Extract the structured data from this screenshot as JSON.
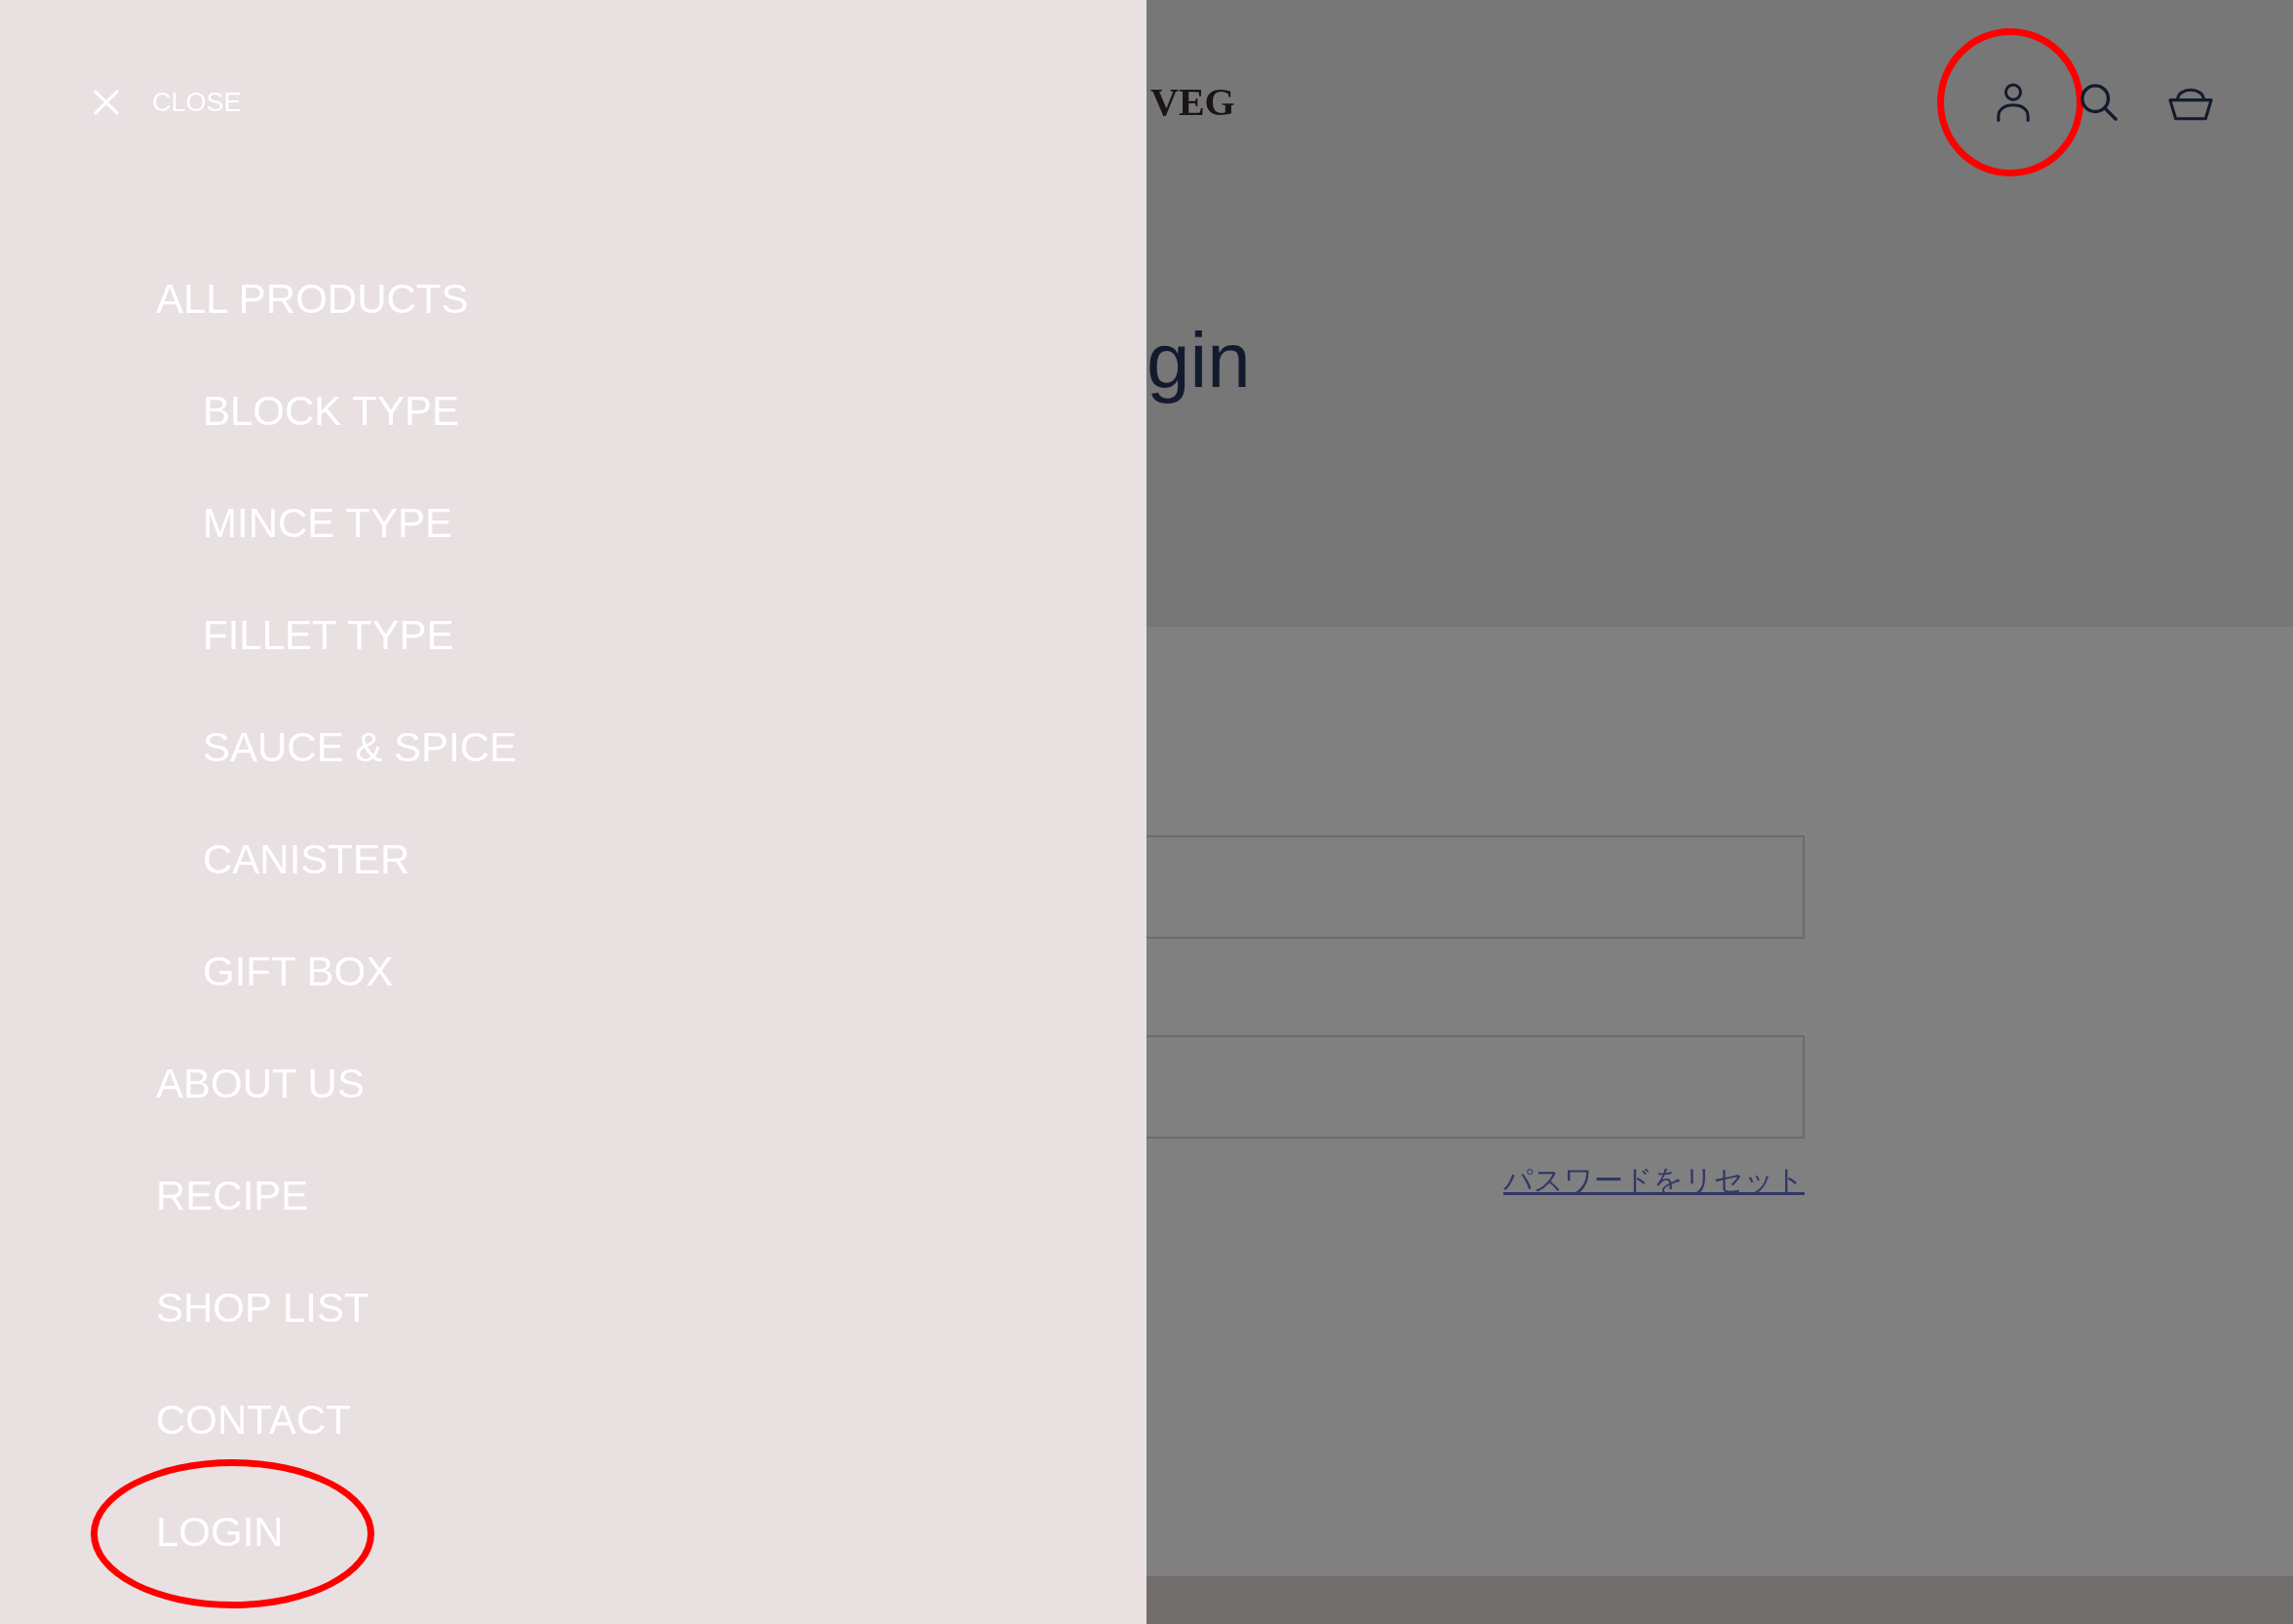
{
  "drawer": {
    "close": {
      "label": "CLOSE"
    },
    "menu": [
      {
        "label": "ALL PRODUCTS",
        "highlighted": false,
        "children": [
          {
            "label": "BLOCK TYPE",
            "highlighted": false
          },
          {
            "label": "MINCE TYPE",
            "highlighted": false
          },
          {
            "label": "FILLET TYPE",
            "highlighted": false
          },
          {
            "label": "SAUCE & SPICE",
            "highlighted": false
          },
          {
            "label": "CANISTER",
            "highlighted": false
          },
          {
            "label": "GIFT BOX",
            "highlighted": false
          }
        ]
      },
      {
        "label": "ABOUT US",
        "highlighted": false
      },
      {
        "label": "RECIPE",
        "highlighted": false
      },
      {
        "label": "SHOP LIST",
        "highlighted": false
      },
      {
        "label": "CONTACT",
        "highlighted": false
      },
      {
        "label": "LOGIN",
        "highlighted": true
      }
    ]
  },
  "header": {
    "logo": "VEG",
    "icons": [
      {
        "kind": "account",
        "highlighted": true
      },
      {
        "kind": "search",
        "highlighted": false
      },
      {
        "kind": "cart",
        "highlighted": false
      }
    ]
  },
  "page": {
    "title": "gin",
    "fields": [
      {
        "kind": "input"
      },
      {
        "kind": "input"
      }
    ],
    "reset_link": "パスワードをリセット"
  }
}
